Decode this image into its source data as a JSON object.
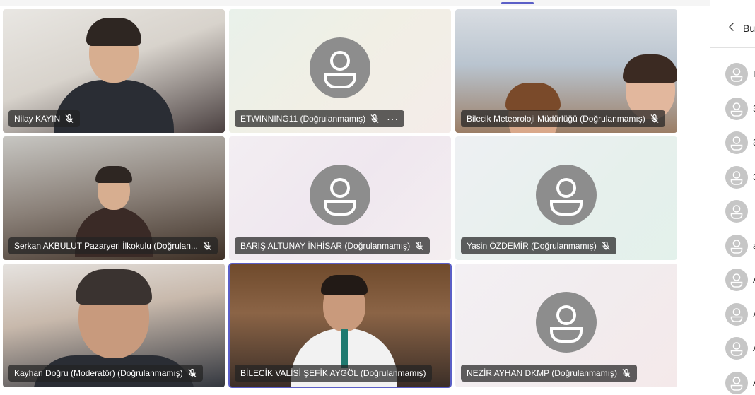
{
  "colors": {
    "accent": "#5b5fc7",
    "avatar_grey": "#8d8d8d",
    "label_bg": "#232323"
  },
  "tiles": [
    {
      "name": "Nilay KAYIN",
      "muted": true,
      "kind": "video"
    },
    {
      "name": "ETWINNING11 (Doğrulanmamış)",
      "muted": true,
      "kind": "avatar",
      "more": "···"
    },
    {
      "name": "Bilecik Meteoroloji Müdürlüğü (Doğrulanmamış)",
      "muted": true,
      "kind": "video"
    },
    {
      "name": "Serkan AKBULUT Pazaryeri İlkokulu (Doğrulan...",
      "muted": true,
      "kind": "video"
    },
    {
      "name": "BARIŞ ALTUNAY İNHİSAR (Doğrulanmamış)",
      "muted": true,
      "kind": "avatar"
    },
    {
      "name": "Yasin ÖZDEMİR (Doğrulanmamış)",
      "muted": true,
      "kind": "avatar"
    },
    {
      "name": "Kayhan Doğru (Moderatör) (Doğrulanmamış)",
      "muted": true,
      "kind": "video"
    },
    {
      "name": "BİLECİK VALİSİ ŞEFİK AYGÖL (Doğrulanmamış)",
      "muted": false,
      "kind": "video",
      "speaking": true
    },
    {
      "name": "NEZİR AYHAN DKMP (Doğrulanmamış)",
      "muted": true,
      "kind": "avatar"
    }
  ],
  "panel": {
    "title": "Bu",
    "back_icon": "chevron-left-icon",
    "participants": [
      {
        "initial": "I"
      },
      {
        "initial": "3"
      },
      {
        "initial": "3"
      },
      {
        "initial": "3"
      },
      {
        "initial": "T"
      },
      {
        "initial": "a"
      },
      {
        "initial": "A"
      },
      {
        "initial": "A"
      },
      {
        "initial": "A"
      },
      {
        "initial": "A"
      }
    ]
  }
}
